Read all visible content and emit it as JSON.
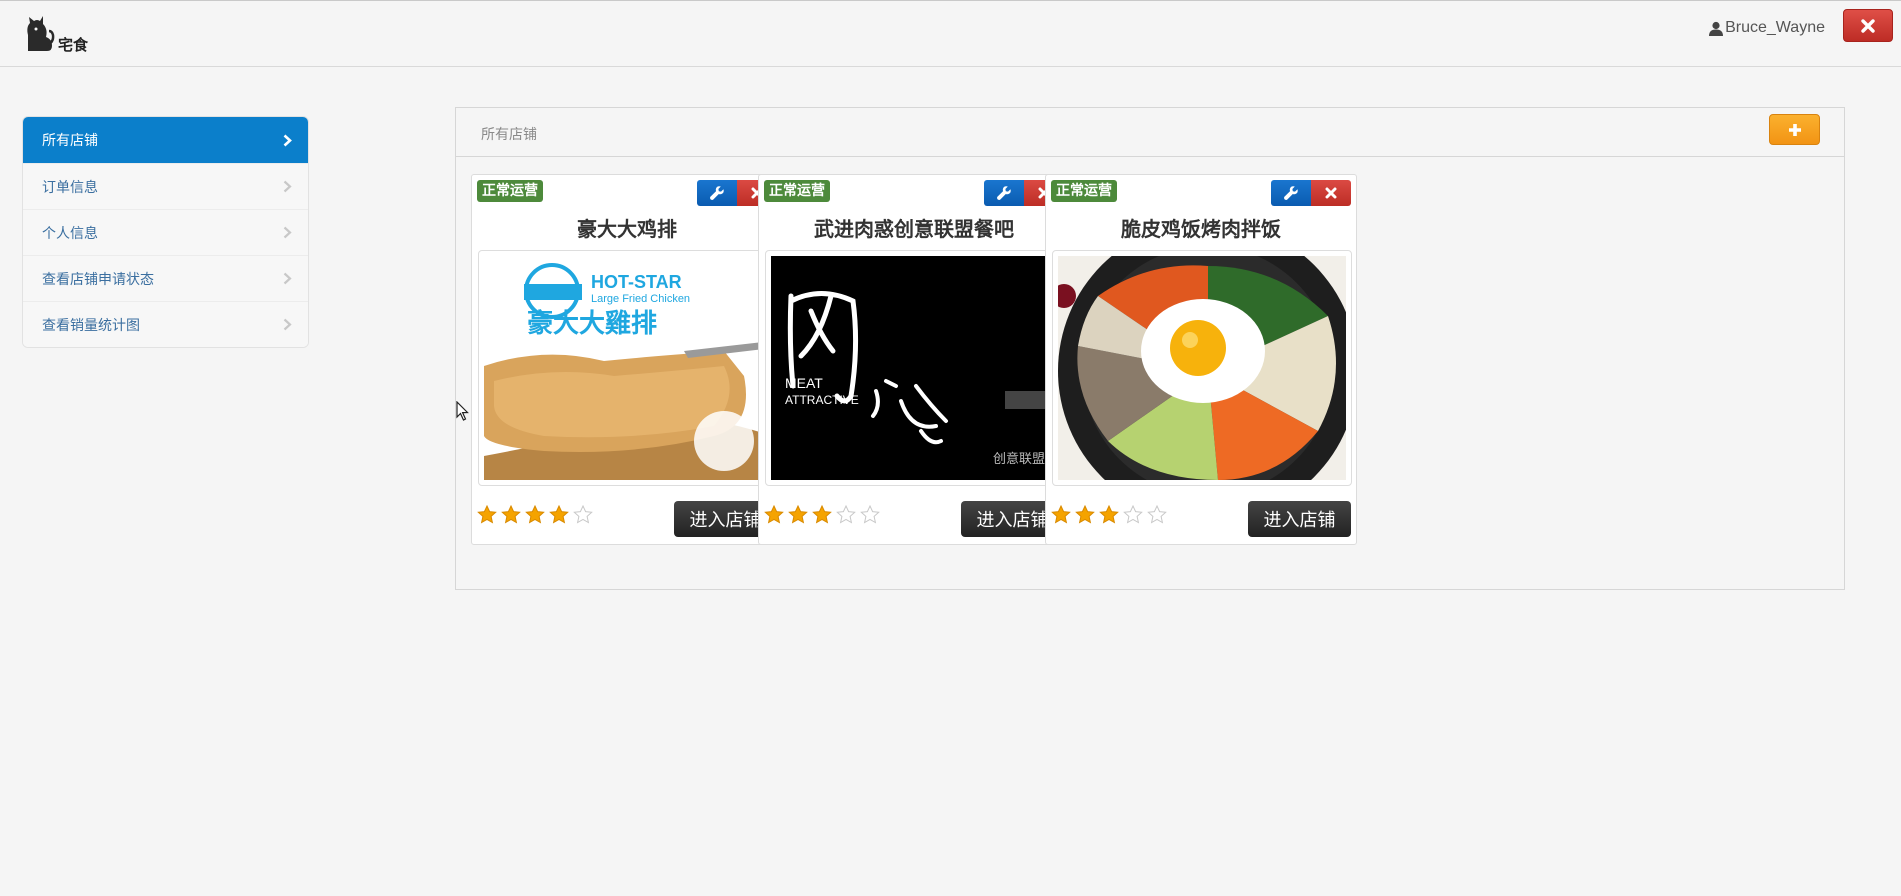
{
  "brand": {
    "name": "宅食"
  },
  "user": {
    "name": "Bruce_Wayne"
  },
  "sidebar": {
    "items": [
      {
        "label": "所有店铺",
        "active": true
      },
      {
        "label": "订单信息"
      },
      {
        "label": "个人信息"
      },
      {
        "label": "查看店铺申请状态"
      },
      {
        "label": "查看销量统计图"
      }
    ]
  },
  "panel": {
    "title": "所有店铺"
  },
  "shops": [
    {
      "status": "正常运营",
      "name": "豪大大鸡排",
      "rating": 4,
      "enter_label": "进入店铺",
      "image": {
        "logo_title": "HOT-STAR",
        "logo_sub": "Large Fried Chicken",
        "cn": "豪大大雞排"
      }
    },
    {
      "status": "正常运营",
      "name": "武进肉惑创意联盟餐吧",
      "rating": 3,
      "enter_label": "进入店铺",
      "image": {
        "line1": "MEAT",
        "line2": "ATTRACTIVE",
        "corner": "创意联盟"
      }
    },
    {
      "status": "正常运营",
      "name": "脆皮鸡饭烤肉拌饭",
      "rating": 3,
      "enter_label": "进入店铺"
    }
  ],
  "max_rating": 5,
  "colors": {
    "accent": "#0b7fcb",
    "status_green": "#4d8a3b",
    "star_filled": "#f5a300",
    "add_button": "#f29414",
    "danger": "#bd2c25"
  }
}
